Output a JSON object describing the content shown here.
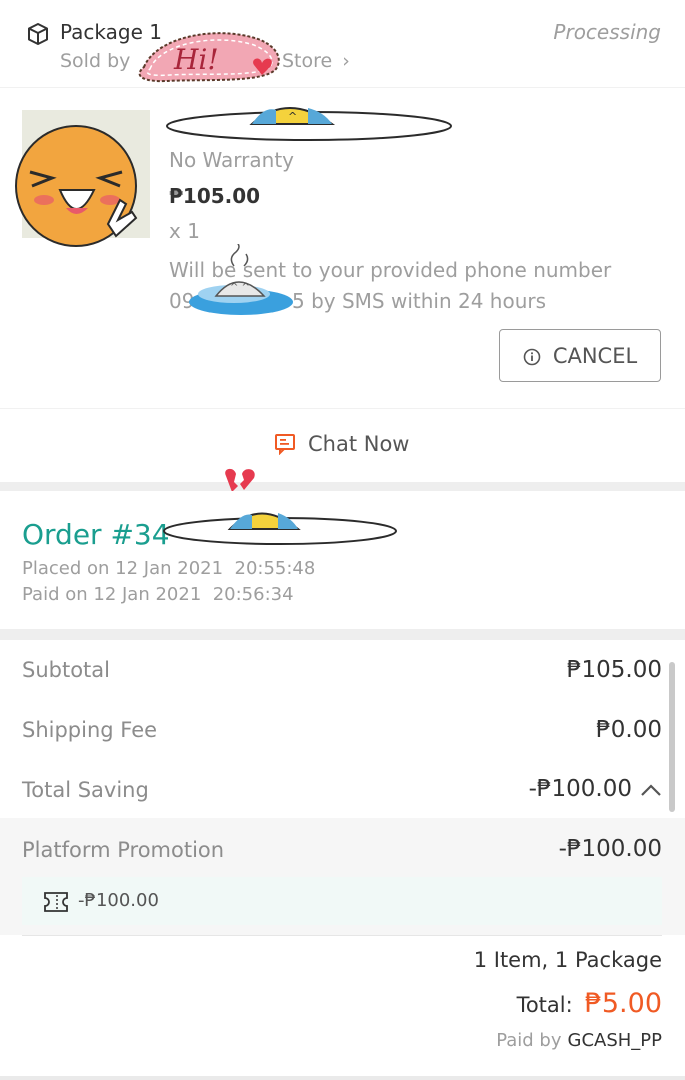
{
  "package": {
    "title": "Package 1",
    "status": "Processing",
    "sold_by_prefix": "Sold by",
    "store_suffix": "Store",
    "chevron": "›",
    "warranty": "No Warranty",
    "price": "₱105.00",
    "quantity": "x 1",
    "sms_line1": "Will be sent to your provided phone number",
    "sms_line2_prefix": "09",
    "sms_line2_suffix": "5 by SMS within 24 hours",
    "cancel_label": "CANCEL",
    "chat_label": "Chat Now"
  },
  "order": {
    "number_prefix": "Order #34",
    "placed": "Placed on 12 Jan 2021  20:55:48",
    "paid": "Paid on 12 Jan 2021  20:56:34"
  },
  "summary": {
    "subtotal_label": "Subtotal",
    "subtotal_value": "₱105.00",
    "shipping_label": "Shipping Fee",
    "shipping_value": "₱0.00",
    "saving_label": "Total Saving",
    "saving_value": "-₱100.00",
    "promo_label": "Platform Promotion",
    "promo_value": "-₱100.00",
    "voucher_value": "-₱100.00",
    "items_line": "1 Item, 1 Package",
    "total_label": "Total:",
    "total_value": "₱5.00",
    "paid_by_label": "Paid by",
    "paid_by_value": "GCASH_PP"
  },
  "stickers": {
    "hi_text": "Hi!"
  },
  "colors": {
    "accent_teal": "#1a9e8f",
    "total_orange": "#f05a24",
    "chat_icon": "#f05a24"
  },
  "icons": {
    "package": "package-icon",
    "info": "info-icon",
    "chat": "chat-icon",
    "chevron_up": "chevron-up-icon",
    "voucher": "voucher-icon"
  }
}
